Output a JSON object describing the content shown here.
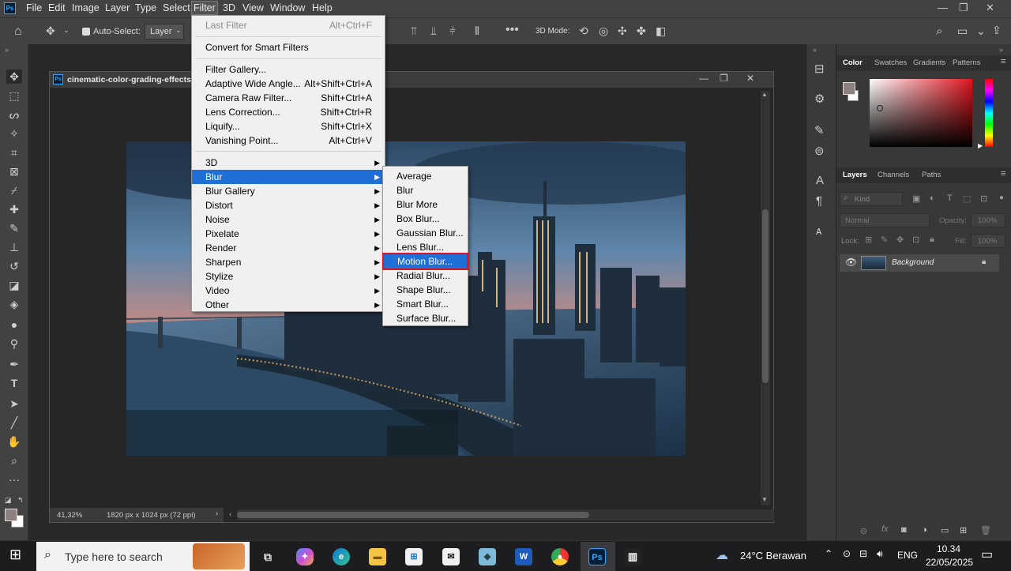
{
  "menubar": {
    "items": [
      "File",
      "Edit",
      "Image",
      "Layer",
      "Type",
      "Select",
      "Filter",
      "3D",
      "View",
      "Window",
      "Help"
    ]
  },
  "options": {
    "auto_select_label": "Auto-Select:",
    "layer_select": "Layer",
    "mode_3d": "3D Mode:"
  },
  "document": {
    "title": "cinematic-color-grading-effects-",
    "zoom": "41,32%",
    "dimensions": "1820 px x 1024 px (72 ppi)"
  },
  "filter_menu": {
    "items": [
      {
        "label": "Last Filter",
        "shortcut": "Alt+Ctrl+F",
        "disabled": true
      },
      {
        "label": "Convert for Smart Filters",
        "shortcut": ""
      },
      {
        "label": "Filter Gallery...",
        "shortcut": ""
      },
      {
        "label": "Adaptive Wide Angle...",
        "shortcut": "Alt+Shift+Ctrl+A"
      },
      {
        "label": "Camera Raw Filter...",
        "shortcut": "Shift+Ctrl+A"
      },
      {
        "label": "Lens Correction...",
        "shortcut": "Shift+Ctrl+R"
      },
      {
        "label": "Liquify...",
        "shortcut": "Shift+Ctrl+X"
      },
      {
        "label": "Vanishing Point...",
        "shortcut": "Alt+Ctrl+V"
      },
      {
        "label": "3D",
        "shortcut": ""
      },
      {
        "label": "Blur",
        "shortcut": ""
      },
      {
        "label": "Blur Gallery",
        "shortcut": ""
      },
      {
        "label": "Distort",
        "shortcut": ""
      },
      {
        "label": "Noise",
        "shortcut": ""
      },
      {
        "label": "Pixelate",
        "shortcut": ""
      },
      {
        "label": "Render",
        "shortcut": ""
      },
      {
        "label": "Sharpen",
        "shortcut": ""
      },
      {
        "label": "Stylize",
        "shortcut": ""
      },
      {
        "label": "Video",
        "shortcut": ""
      },
      {
        "label": "Other",
        "shortcut": ""
      }
    ]
  },
  "blur_submenu": {
    "items": [
      "Average",
      "Blur",
      "Blur More",
      "Box Blur...",
      "Gaussian Blur...",
      "Lens Blur...",
      "Motion Blur...",
      "Radial Blur...",
      "Shape Blur...",
      "Smart Blur...",
      "Surface Blur..."
    ]
  },
  "color_panel": {
    "tabs": [
      "Color",
      "Swatches",
      "Gradients",
      "Patterns"
    ]
  },
  "layers_panel": {
    "tabs": [
      "Layers",
      "Channels",
      "Paths"
    ],
    "kind_placeholder": "Kind",
    "blend_mode": "Normal",
    "opacity_label": "Opacity:",
    "opacity_value": "100%",
    "lock_label": "Lock:",
    "fill_label": "Fill:",
    "fill_value": "100%",
    "layers": [
      {
        "name": "Background"
      }
    ]
  },
  "taskbar": {
    "search_placeholder": "Type here to search",
    "weather": "24°C  Berawan",
    "language": "ENG",
    "time": "10.34",
    "date": "22/05/2025"
  },
  "colors": {
    "highlight": "#1f6fd6",
    "outline_red": "#e0141e",
    "ui_dark": "#424242"
  }
}
